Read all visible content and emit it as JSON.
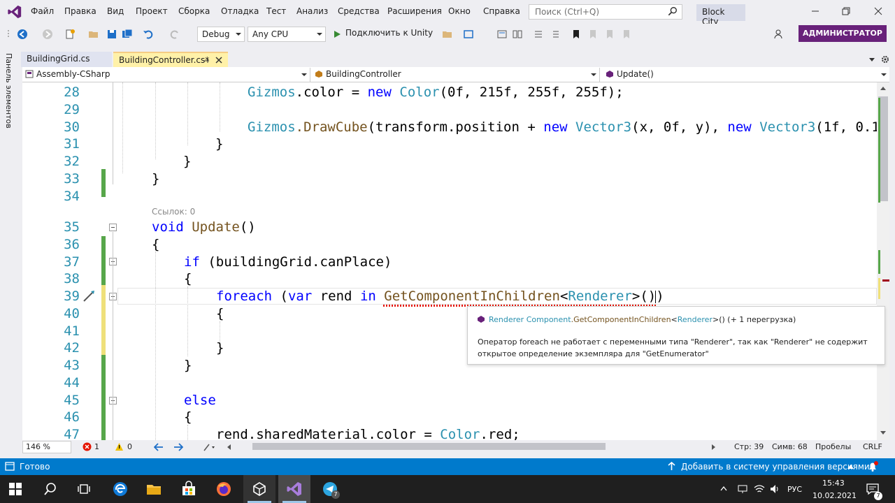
{
  "menu": {
    "items": [
      "Файл",
      "Правка",
      "Вид",
      "Проект",
      "Сборка",
      "Отладка",
      "Тест",
      "Анализ",
      "Средства",
      "Расширения",
      "Окно",
      "Справка"
    ],
    "search_placeholder": "Поиск (Ctrl+Q)",
    "solution_name": "Block City"
  },
  "toolbar": {
    "config": "Debug",
    "platform": "Any CPU",
    "attach_label": "Подключить к Unity",
    "admin_label": "АДМИНИСТРАТОР"
  },
  "left_strip": {
    "label": "Панель элементов"
  },
  "tabs": [
    {
      "label": "BuildingGrid.cs",
      "active": false
    },
    {
      "label": "BuildingController.cs*",
      "active": true
    }
  ],
  "navbar": {
    "project": "Assembly-CSharp",
    "class": "BuildingController",
    "member": "Update()"
  },
  "editor": {
    "line_numbers": [
      "28",
      "29",
      "30",
      "31",
      "32",
      "33",
      "34",
      "35",
      "36",
      "37",
      "38",
      "39",
      "40",
      "41",
      "42",
      "43",
      "44",
      "45",
      "46",
      "47"
    ],
    "lines": {
      "l28": {
        "obj": "Gizmos",
        "rest1": ".color = ",
        "kw": "new",
        "ty": "Color",
        "rest2": "(0f, 215f, 255f, 255f);"
      },
      "l30": {
        "obj": "Gizmos",
        "method": ".DrawCube",
        "rest1": "(transform.position + ",
        "kw1": "new",
        "ty1": "Vector3",
        "rest2": "(x, 0f, y), ",
        "kw2": "new",
        "ty2": "Vector3",
        "rest3": "(1f, 0.1"
      },
      "l31": "}",
      "l32": "}",
      "l33": "}",
      "reference_count": "Ссылок: 0",
      "l35": {
        "kw": "void",
        "name": "Update",
        "rest": "()"
      },
      "l36": "{",
      "l37": {
        "kw": "if",
        "rest": " (buildingGrid.canPlace)"
      },
      "l38": "{",
      "l39": {
        "kw1": "foreach",
        "p1": " (",
        "kw2": "var",
        "p2": " rend ",
        "kw3": "in",
        "p3": " ",
        "method": "GetComponentInChildren",
        "lt": "<",
        "ty": "Renderer",
        "end": ">())"
      },
      "l40": "{",
      "l42": "}",
      "l43": "}",
      "l45": {
        "kw": "else"
      },
      "l46": "{",
      "l47": {
        "rest": "rend.sharedMaterial.color = ",
        "ty": "Color",
        "end": ".red;"
      }
    }
  },
  "tooltip": {
    "sig_ret": "Renderer",
    "sig_cls": "Component",
    "sig_method": ".GetComponentInChildren",
    "sig_lt": "<",
    "sig_ty": "Renderer",
    "sig_end": ">() (+ 1 перегрузка)",
    "description": "Оператор foreach не работает с переменными типа \"Renderer\", так как \"Renderer\" не содержит открытое определение экземпляра для \"GetEnumerator\""
  },
  "editor_footer": {
    "zoom": "146 %",
    "errors": "1",
    "warnings": "0",
    "line": "Стр: 39",
    "col": "Симв: 68",
    "whitespace": "Пробелы",
    "eol": "CRLF"
  },
  "statusbar": {
    "ready": "Готово",
    "source_control": "Добавить в систему управления версиями"
  },
  "taskbar": {
    "lang": "РУС",
    "time": "15:43",
    "date": "10.02.2021",
    "telegram_badge": "7"
  },
  "colors": {
    "accent": "#68217a",
    "status": "#007acc",
    "keyword": "#0000ff",
    "type": "#2b91af",
    "method": "#74531f"
  }
}
